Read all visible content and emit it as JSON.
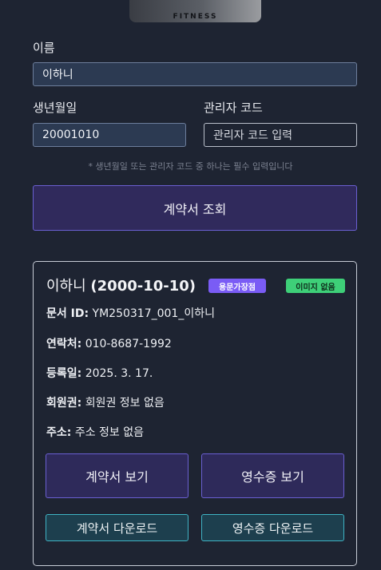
{
  "logo": {
    "text": "FITNESS"
  },
  "form": {
    "name_label": "이름",
    "name_value": "이하니",
    "birth_label": "생년월일",
    "birth_value": "20001010",
    "admin_label": "관리자 코드",
    "admin_placeholder": "관리자 코드 입력",
    "hint": "* 생년월일 또는 관리자 코드 중 하나는 필수 입력입니다",
    "submit_label": "계약서 조회"
  },
  "result": {
    "name": "이하니",
    "birth": "(2000-10-10)",
    "badge_store": "용문가장점",
    "badge_image": "이미지 없음",
    "doc_id_label": "문서 ID:",
    "doc_id_value": "YM250317_001_이하니",
    "contact_label": "연락처:",
    "contact_value": "010-8687-1992",
    "reg_date_label": "등록일:",
    "reg_date_value": "2025. 3. 17.",
    "membership_label": "회원권:",
    "membership_value": "회원권 정보 없음",
    "address_label": "주소:",
    "address_value": "주소 정보 없음",
    "view_contract_label": "계약서 보기",
    "view_receipt_label": "영수증 보기",
    "download_contract_label": "계약서 다운로드",
    "download_receipt_label": "영수증 다운로드"
  },
  "colors": {
    "background": "#1e2432",
    "primary_button": "#302a5c",
    "primary_border": "#6a5fd1",
    "download_button": "#1d3f4e",
    "download_border": "#3fb3c4",
    "badge_store": "#7a5cf5",
    "badge_image": "#3ecf78"
  }
}
